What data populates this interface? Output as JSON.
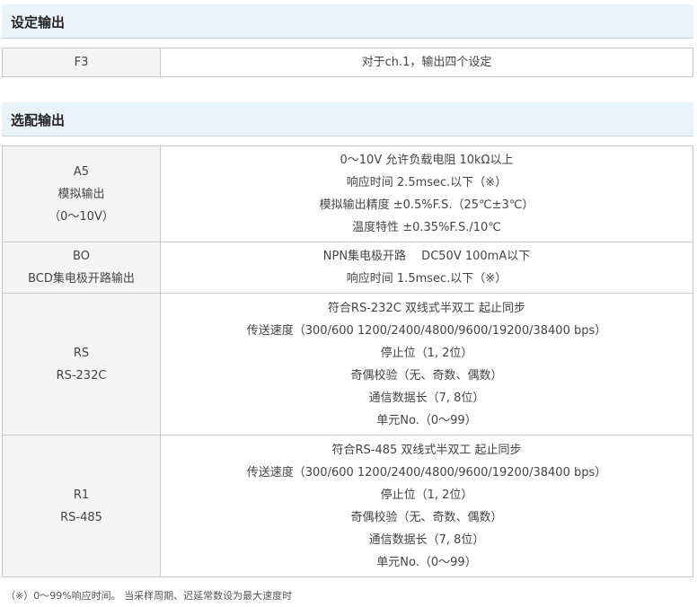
{
  "sections": {
    "setting_output": {
      "title": "设定输出",
      "rows": [
        {
          "label": [
            "F3"
          ],
          "desc": [
            "对于ch.1，输出四个设定"
          ]
        }
      ]
    },
    "option_output": {
      "title": "选配输出",
      "rows": [
        {
          "label": [
            "A5",
            "模拟输出",
            "（0～10V）"
          ],
          "desc": [
            "0～10V 允许负载电阻 10kΩ以上",
            "响应时间 2.5msec.以下（※）",
            "模拟输出精度 ±0.5%F.S.（25℃±3℃）",
            "温度特性 ±0.35%F.S./10℃"
          ]
        },
        {
          "label": [
            "BO",
            "BCD集电极开路输出"
          ],
          "desc": [
            "NPN集电极开路　 DC50V 100mA以下",
            "响应时间 1.5msec.以下（※）"
          ]
        },
        {
          "label": [
            "RS",
            "RS-232C"
          ],
          "desc": [
            "符合RS-232C 双线式半双工 起止同步",
            "传送速度（300/600 1200/2400/4800/9600/19200/38400 bps）",
            "停止位（1, 2位）",
            "奇偶校验（无、奇数、偶数）",
            "通信数据长（7, 8位）",
            "单元No.（0～99）"
          ]
        },
        {
          "label": [
            "R1",
            "RS-485"
          ],
          "desc": [
            "符合RS-485 双线式半双工 起止同步",
            "传送速度（300/600 1200/2400/4800/9600/19200/38400 bps）",
            "停止位（1, 2位）",
            "奇偶校验（无、奇数、偶数）",
            "通信数据长（7, 8位）",
            "单元No.（0～99）"
          ]
        }
      ]
    }
  },
  "footnote": "（※）0～99%响应时间。 当采样周期、迟延常数设为最大速度时"
}
